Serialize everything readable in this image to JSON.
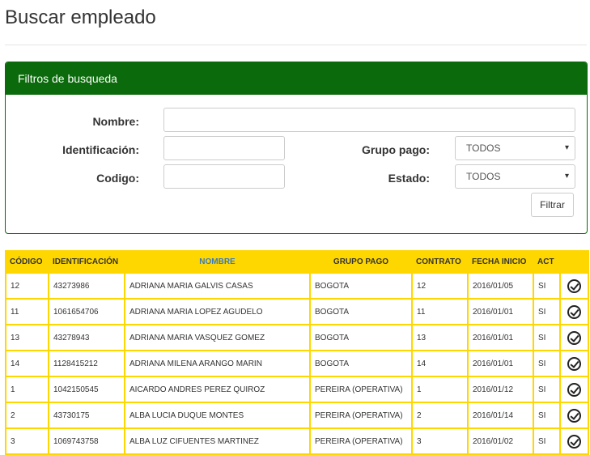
{
  "page": {
    "title": "Buscar empleado"
  },
  "filters": {
    "heading": "Filtros de busqueda",
    "nombre_label": "Nombre:",
    "identificacion_label": "Identificación:",
    "codigo_label": "Codigo:",
    "grupo_pago_label": "Grupo pago:",
    "estado_label": "Estado:",
    "grupo_pago_value": "TODOS",
    "estado_value": "TODOS",
    "filter_button": "Filtrar",
    "arrow": "▾"
  },
  "table": {
    "headers": [
      "CÓDIGO",
      "IDENTIFICACIÓN",
      "NOMBRE",
      "GRUPO PAGO",
      "CONTRATO",
      "FECHA INICIO",
      "ACT"
    ],
    "rows": [
      {
        "codigo": "12",
        "identificacion": "43273986",
        "nombre": "ADRIANA MARIA GALVIS CASAS",
        "grupo": "BOGOTA",
        "contrato": "12",
        "fecha": "2016/01/05",
        "act": "SI"
      },
      {
        "codigo": "11",
        "identificacion": "1061654706",
        "nombre": "ADRIANA MARIA LOPEZ AGUDELO",
        "grupo": "BOGOTA",
        "contrato": "11",
        "fecha": "2016/01/01",
        "act": "SI"
      },
      {
        "codigo": "13",
        "identificacion": "43278943",
        "nombre": "ADRIANA MARIA VASQUEZ GOMEZ",
        "grupo": "BOGOTA",
        "contrato": "13",
        "fecha": "2016/01/01",
        "act": "SI"
      },
      {
        "codigo": "14",
        "identificacion": "1128415212",
        "nombre": "ADRIANA MILENA ARANGO MARIN",
        "grupo": "BOGOTA",
        "contrato": "14",
        "fecha": "2016/01/01",
        "act": "SI"
      },
      {
        "codigo": "1",
        "identificacion": "1042150545",
        "nombre": "AICARDO ANDRES PEREZ QUIROZ",
        "grupo": "PEREIRA (OPERATIVA)",
        "contrato": "1",
        "fecha": "2016/01/12",
        "act": "SI"
      },
      {
        "codigo": "2",
        "identificacion": "43730175",
        "nombre": "ALBA LUCIA DUQUE MONTES",
        "grupo": "PEREIRA (OPERATIVA)",
        "contrato": "2",
        "fecha": "2016/01/14",
        "act": "SI"
      },
      {
        "codigo": "3",
        "identificacion": "1069743758",
        "nombre": "ALBA LUZ CIFUENTES MARTINEZ",
        "grupo": "PEREIRA (OPERATIVA)",
        "contrato": "3",
        "fecha": "2016/01/02",
        "act": "SI"
      }
    ],
    "select_icon": "check-circle-icon"
  }
}
